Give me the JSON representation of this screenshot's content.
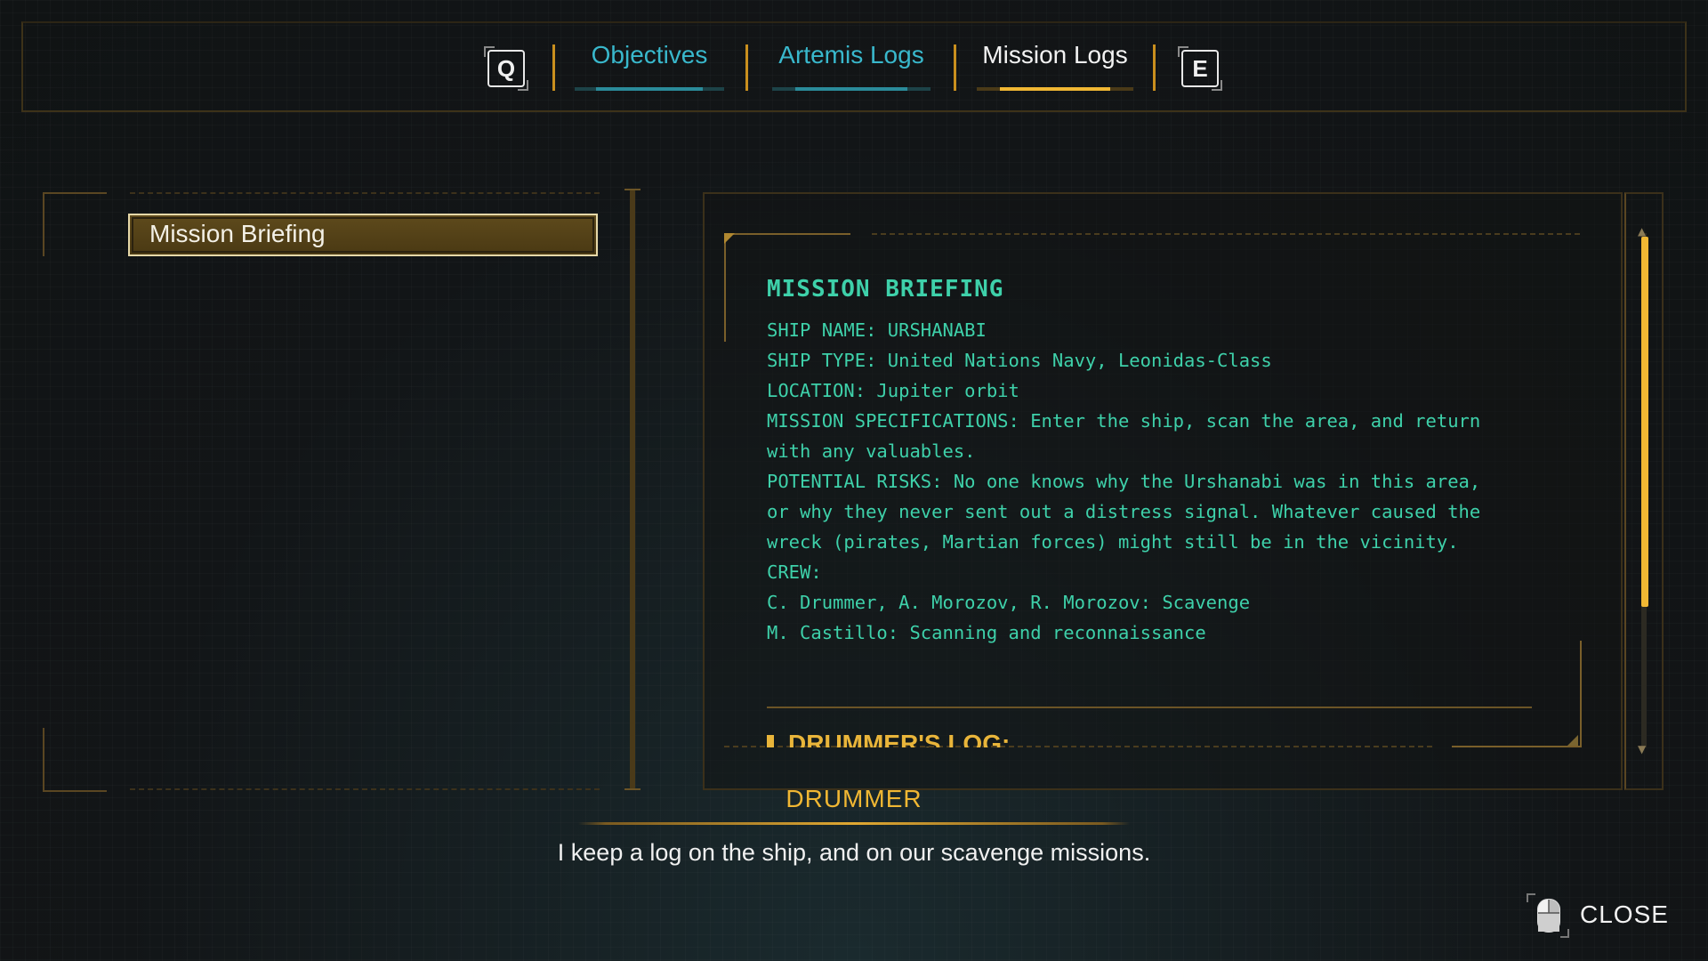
{
  "tabs": {
    "prev_key": "Q",
    "next_key": "E",
    "items": [
      {
        "label": "Objectives",
        "active": false
      },
      {
        "label": "Artemis Logs",
        "active": false
      },
      {
        "label": "Mission Logs",
        "active": true
      }
    ]
  },
  "log_list": {
    "items": [
      {
        "label": "Mission Briefing",
        "selected": true
      }
    ]
  },
  "detail": {
    "title": "MISSION BRIEFING",
    "lines": [
      "SHIP NAME: URSHANABI",
      "SHIP TYPE: United Nations Navy, Leonidas-Class",
      "LOCATION: Jupiter orbit",
      "MISSION SPECIFICATIONS: Enter the ship, scan the area, and return",
      "with any valuables.",
      "POTENTIAL RISKS: No one knows why the Urshanabi was in this area,",
      "or why they never sent out a distress signal. Whatever caused the",
      "wreck (pirates, Martian forces) might still be in the vicinity.",
      "CREW:",
      "C. Drummer, A. Morozov, R. Morozov: Scavenge",
      "M. Castillo: Scanning and reconnaissance"
    ],
    "next_entry": "DRUMMER'S LOG:",
    "scroll_fraction_visible": 0.72
  },
  "subtitle": {
    "speaker": "DRUMMER",
    "text": "I keep a log on the ship, and on our scavenge missions."
  },
  "close": {
    "label": "CLOSE",
    "icon": "mouse-icon"
  },
  "colors": {
    "accent_gold": "#f0b733",
    "teal_text": "#3ed1aa",
    "tab_inactive": "#39b8cc"
  }
}
